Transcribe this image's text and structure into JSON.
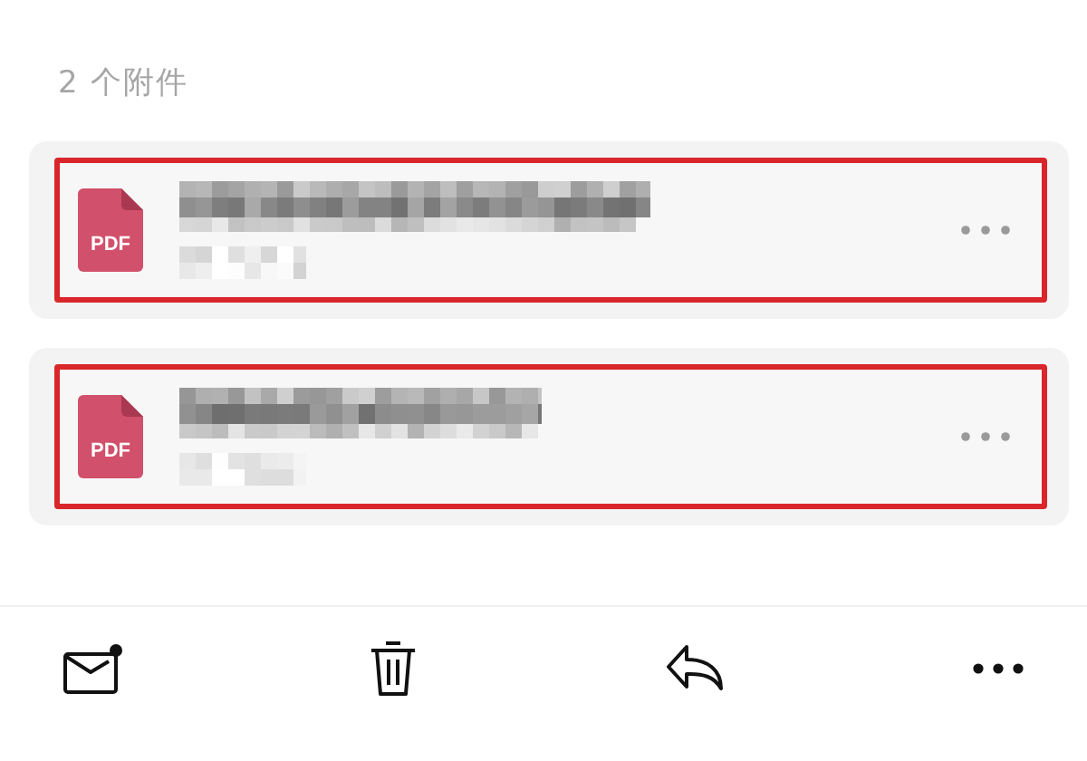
{
  "header": {
    "title": "2 个附件"
  },
  "attachments": [
    {
      "kind": "pdf",
      "icon_label": "PDF",
      "redacted": true,
      "highlighted": true
    },
    {
      "kind": "pdf",
      "icon_label": "PDF",
      "redacted": true,
      "highlighted": true
    }
  ],
  "toolbar": [
    {
      "kind": "mail",
      "badge": true
    },
    {
      "kind": "delete"
    },
    {
      "kind": "reply"
    },
    {
      "kind": "more"
    }
  ]
}
